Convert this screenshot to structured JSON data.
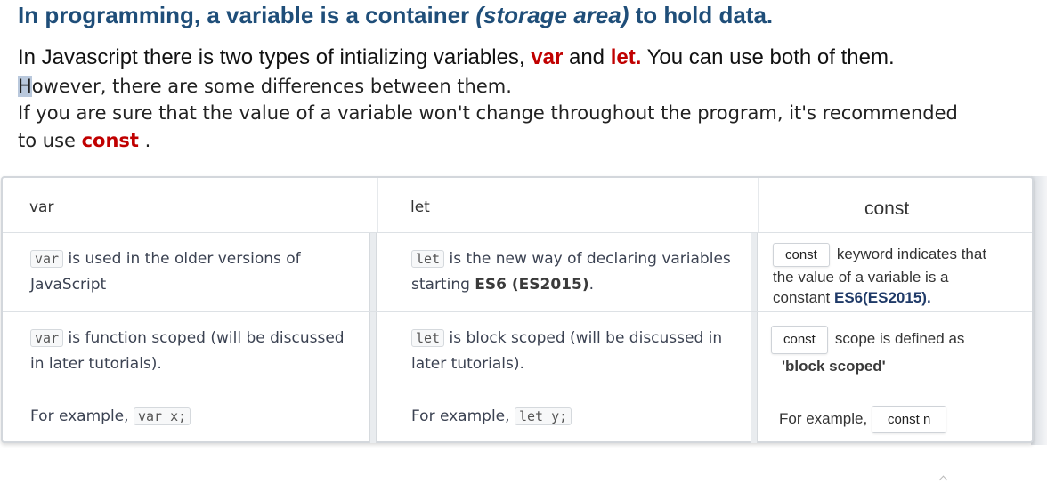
{
  "heading": {
    "part1": "In programming, a variable is a container ",
    "part2": "(storage area)",
    "part3": " to hold data."
  },
  "para1": {
    "text1": "In Javascript there is two types of intializing variables, ",
    "kw1": "var",
    "text2": " and ",
    "kw2": "let.",
    "text3": " You can use both of them."
  },
  "para2": {
    "first_letter": "H",
    "rest": "owever, there are some differences between them."
  },
  "para3": {
    "line1": "If you are sure that the value of a variable won't change throughout the program, it's recommended",
    "line2_prefix": "to use ",
    "kw": "const",
    "line2_suffix": " ."
  },
  "table": {
    "headers": [
      "var",
      "let",
      "const"
    ],
    "var": {
      "row1_code": "var",
      "row1_line1": " is used in the older versions of",
      "row1_line2": "JavaScript",
      "row2_code": "var",
      "row2_line1": " is function scoped (will be discussed",
      "row2_line2": "in later tutorials).",
      "row3_prefix": "For example, ",
      "row3_code": "var x;"
    },
    "let": {
      "row1_code": "let",
      "row1_line1": " is the new way of declaring variables",
      "row1_line2_prefix": "starting ",
      "row1_line2_bold": "ES6 (ES2015)",
      "row1_line2_suffix": ".",
      "row2_code": "let",
      "row2_line1": " is block scoped (will be discussed in",
      "row2_line2": "later tutorials).",
      "row3_prefix": "For example, ",
      "row3_code": "let y;"
    },
    "const": {
      "row1_badge": "const",
      "row1_line1": "keyword indicates that",
      "row1_line2": "the value of a variable is a",
      "row1_line3_prefix": "constant ",
      "row1_line3_bold": "ES6(ES2015).",
      "row2_badge": "const",
      "row2_line1": "scope is defined as",
      "row2_line2": "'block scoped'",
      "row3_prefix": "For example, ",
      "row3_badge": "const n"
    }
  },
  "colors": {
    "heading": "#1f4e79",
    "keyword": "#c00000",
    "navy_bold": "#1f3a68"
  }
}
